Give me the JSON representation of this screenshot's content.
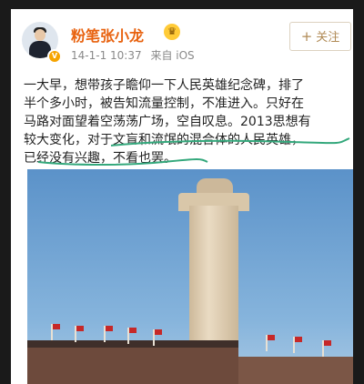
{
  "post": {
    "username": "粉笔张小龙",
    "time": "14-1-1 10:37",
    "source": "来自 iOS",
    "follow_label": "关注",
    "text_lines": [
      "一大早，想带孩子瞻仰一下人民英雄纪念碑，排了",
      "半个多小时，被告知流量控制，不准进入。只好在",
      "马路对面望着空荡荡广场，空自叹息。2013思想有",
      "较大变化，对于文盲和流氓的混合体的人民英雄，",
      "已经没有兴趣，不看也罢。"
    ]
  },
  "icons": {
    "verified": "v-badge",
    "crown": "crown-icon",
    "plus": "plus-icon"
  },
  "colors": {
    "username": "#e8620f",
    "follow_text": "#b08a55",
    "underline": "#34a87c"
  }
}
